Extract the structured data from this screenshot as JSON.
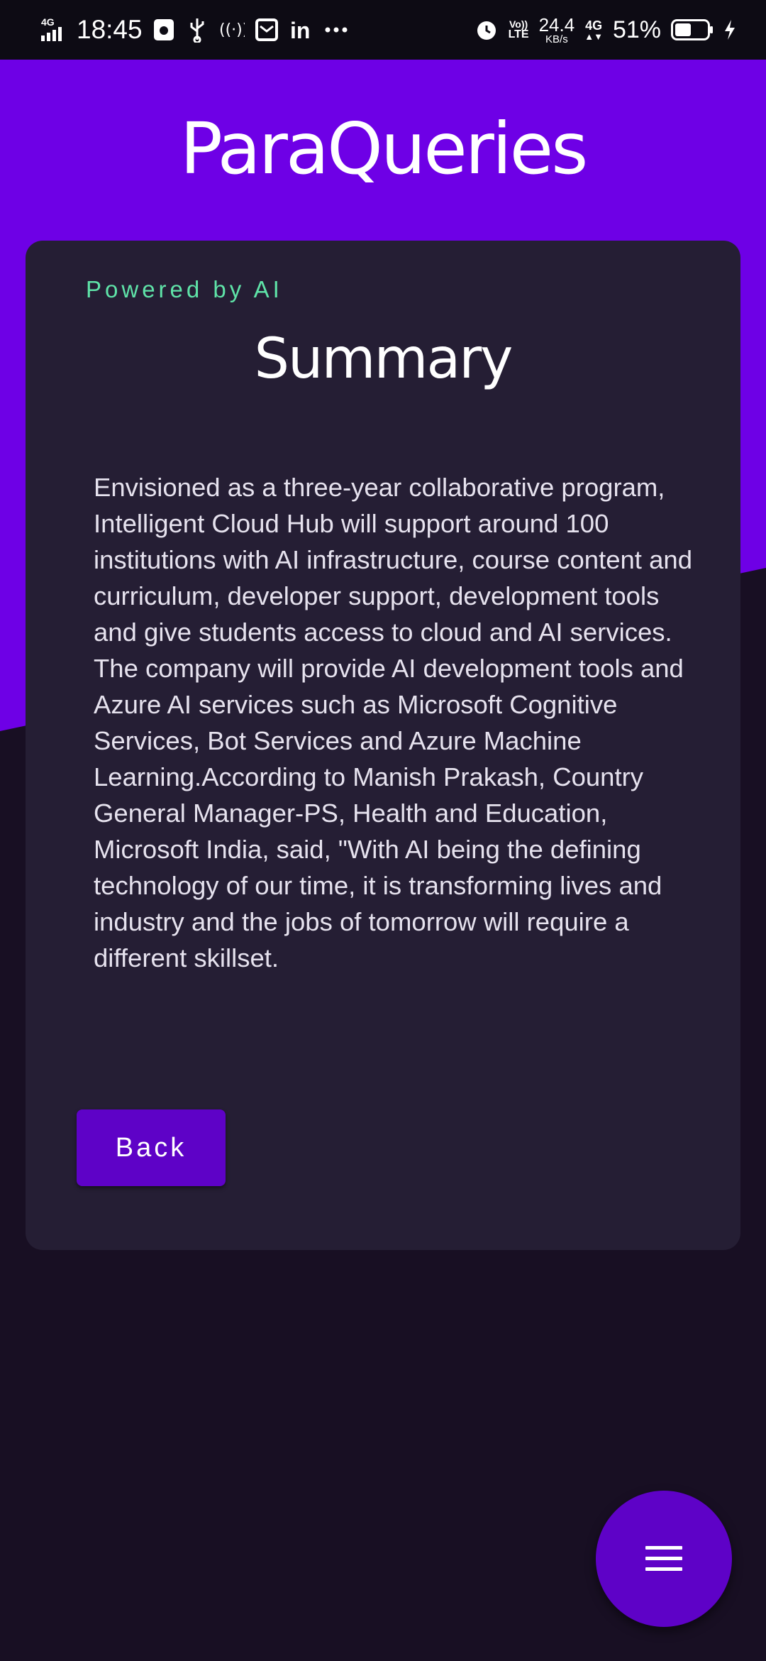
{
  "status_bar": {
    "network_left": "4G",
    "time": "18:45",
    "more_icon": "more-dots-icon",
    "lte_top": "Vo))",
    "lte_bottom": "LTE",
    "speed_value": "24.4",
    "speed_unit": "KB/s",
    "network_right": "4G",
    "battery_percent": "51%",
    "battery_level": 0.51
  },
  "header": {
    "title": "ParaQueries"
  },
  "card": {
    "powered_label": "Powered by AI",
    "title": "Summary",
    "summary_text": "Envisioned as a three-year collaborative program, Intelligent Cloud Hub will support around 100 institutions with AI infrastructure, course content and curriculum, developer support, development tools and give students access to cloud and AI services. The company will provide AI development tools and Azure AI services such as Microsoft Cognitive Services, Bot Services and Azure Machine Learning.According to Manish Prakash, Country General Manager-PS, Health and Education, Microsoft India, said, \"With AI being the defining technology of our time, it is transforming lives and industry and the jobs of tomorrow will require a different skillset.",
    "back_label": "Back"
  },
  "fab": {
    "icon": "menu-icon"
  },
  "colors": {
    "header_purple": "#6e00e6",
    "page_background": "#180f23",
    "card_background": "#251e34",
    "accent_green": "#5fe3a8",
    "button_purple": "#5e02c7"
  }
}
